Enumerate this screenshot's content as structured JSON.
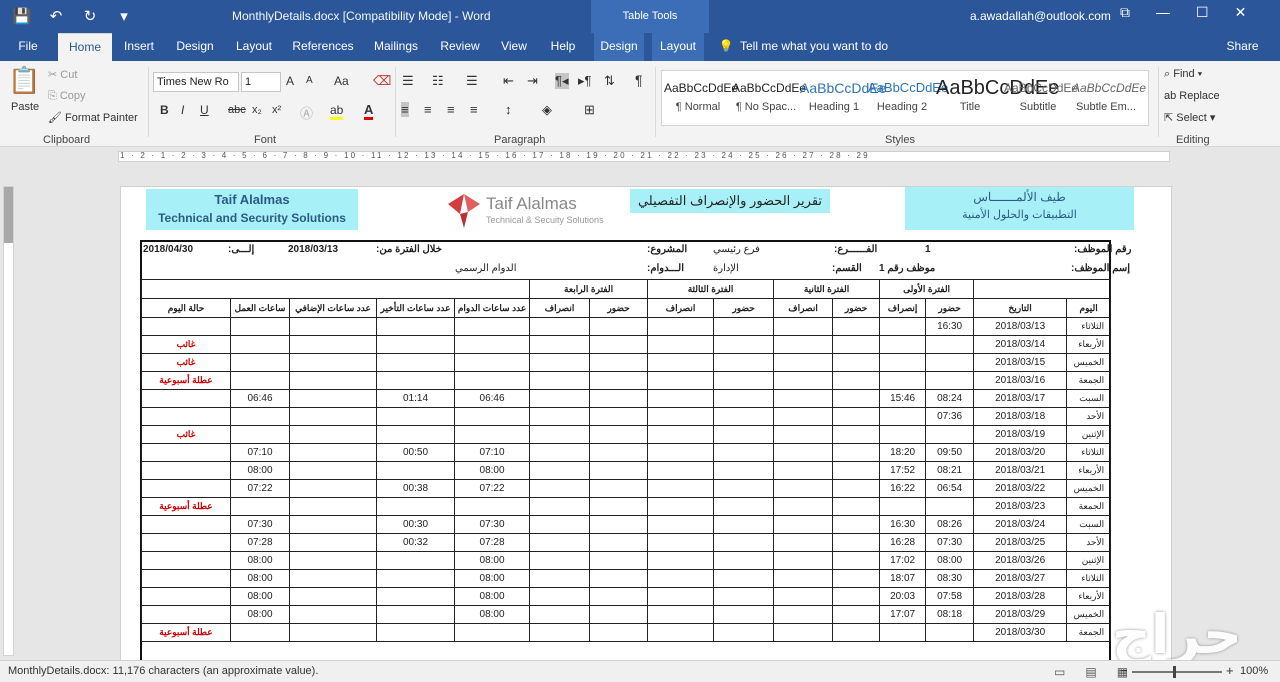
{
  "titlebar": {
    "document_title": "MonthlyDetails.docx [Compatibility Mode]  -  Word",
    "context_tab": "Table Tools",
    "account": "a.awadallah@outlook.com",
    "save_icon": "💾",
    "undo_icon": "↶",
    "redo_icon": "↻",
    "customize_icon": "▾",
    "restore_icon": "⧉",
    "minimize_icon": "—",
    "maximize_icon": "☐",
    "close_icon": "✕"
  },
  "tabs": {
    "file": "File",
    "home": "Home",
    "insert": "Insert",
    "design": "Design",
    "layout": "Layout",
    "references": "References",
    "mailings": "Mailings",
    "review": "Review",
    "view": "View",
    "help": "Help",
    "table_design": "Design",
    "table_layout": "Layout",
    "tell_me": "Tell me what you want to do",
    "share": "Share"
  },
  "clipboard": {
    "paste": "Paste",
    "cut": "Cut",
    "copy": "Copy",
    "format_painter": "Format Painter",
    "label": "Clipboard"
  },
  "font": {
    "name": "Times New Ro",
    "size": "1",
    "label": "Font",
    "bold": "B",
    "italic": "I",
    "underline": "U",
    "strike": "abc",
    "subscript": "x₂",
    "superscript": "x²",
    "grow": "A",
    "shrink": "A",
    "change_case": "Aa",
    "font_color": "A"
  },
  "paragraph": {
    "label": "Paragraph",
    "show_marks": "¶"
  },
  "styles": {
    "label": "Styles",
    "items": [
      {
        "preview": "AaBbCcDdEe",
        "name": "¶ Normal"
      },
      {
        "preview": "AaBbCcDdEe",
        "name": "¶ No Spac..."
      },
      {
        "preview": "AaBbCcDdEe",
        "name": "Heading 1"
      },
      {
        "preview": "AaBbCcDdEe",
        "name": "Heading 2"
      },
      {
        "preview": "AaBbCcDdEe",
        "name": "Title"
      },
      {
        "preview": "AaBbCcDdEe",
        "name": "Subtitle"
      },
      {
        "preview": "AaBbCcDdEe",
        "name": "Subtle Em..."
      }
    ]
  },
  "editing": {
    "label": "Editing",
    "find": "Find",
    "replace": "Replace",
    "select": "Select"
  },
  "ruler": {
    "numbers": "1 · 2 · 1 · 2 · 3 · 4 · 5 · 6 · 7 · 8 · 9 · 10 · 11 · 12 · 13 · 14 · 15 · 16 · 17 · 18 · 19 · 20 · 21 · 22 · 23 · 24 · 25 · 26 · 27 · 28 · 29"
  },
  "document": {
    "company_en_line1": "Taif Alalmas",
    "company_en_line2": "Technical and Security Solutions",
    "logo_name": "Taif Alalmas",
    "logo_tagline": "Technical & Secuity Solutions",
    "report_title": "تقرير الحضور والإنصراف التفصيلي",
    "company_ar_line1": "طيف الألمـــــــاس",
    "company_ar_line2": "التطبيقات والحلول الأمنية",
    "info": {
      "employee_no_label": "رقم الموظف:",
      "employee_no": "1",
      "employee_name_label": "إسم الموظف:",
      "employee_name": "موظف رقم 1",
      "branch_label": "الفــــــرع:",
      "branch": "فرع رئيسي",
      "section_label": "القسم:",
      "section": "الإدارة",
      "project_label": "المشروع:",
      "shift_label": "الـــدوام:",
      "shift": "الدوام الرسمي",
      "period_label": "خلال الفترة من:",
      "from": "2018/03/13",
      "to_label": "إلـــى:",
      "to": "2018/04/30"
    },
    "table": {
      "periods": [
        "الفترة الأولى",
        "الفترة الثانية",
        "الفترة الثالثة",
        "الفترة الرابعة"
      ],
      "headers": [
        "اليوم",
        "التاريخ",
        "حضور",
        "إنصراف",
        "حضور",
        "انصراف",
        "حضور",
        "انصراف",
        "حضور",
        "انصراف",
        "عدد ساعات الدوام",
        "عدد ساعات التأخير",
        "عدد ساعات الإضافي",
        "ساعات العمل",
        "حالة اليوم"
      ],
      "rows": [
        {
          "day": "الثلاثاء",
          "date": "2018/03/13",
          "in1": "16:30",
          "out1": "",
          "duty": "",
          "late": "",
          "work": "",
          "status": ""
        },
        {
          "day": "الأربعاء",
          "date": "2018/03/14",
          "in1": "",
          "out1": "",
          "duty": "",
          "late": "",
          "work": "",
          "status": "غائب"
        },
        {
          "day": "الخميس",
          "date": "2018/03/15",
          "in1": "",
          "out1": "",
          "duty": "",
          "late": "",
          "work": "",
          "status": "غائب"
        },
        {
          "day": "الجمعة",
          "date": "2018/03/16",
          "in1": "",
          "out1": "",
          "duty": "",
          "late": "",
          "work": "",
          "status": "عطلة أسبوعية"
        },
        {
          "day": "السبت",
          "date": "2018/03/17",
          "in1": "08:24",
          "out1": "15:46",
          "duty": "06:46",
          "late": "01:14",
          "work": "06:46",
          "status": ""
        },
        {
          "day": "الأحد",
          "date": "2018/03/18",
          "in1": "07:36",
          "out1": "",
          "duty": "",
          "late": "",
          "work": "",
          "status": ""
        },
        {
          "day": "الإثنين",
          "date": "2018/03/19",
          "in1": "",
          "out1": "",
          "duty": "",
          "late": "",
          "work": "",
          "status": "غائب"
        },
        {
          "day": "الثلاثاء",
          "date": "2018/03/20",
          "in1": "09:50",
          "out1": "18:20",
          "duty": "07:10",
          "late": "00:50",
          "work": "07:10",
          "status": ""
        },
        {
          "day": "الأربعاء",
          "date": "2018/03/21",
          "in1": "08:21",
          "out1": "17:52",
          "duty": "08:00",
          "late": "",
          "work": "08:00",
          "status": ""
        },
        {
          "day": "الخميس",
          "date": "2018/03/22",
          "in1": "06:54",
          "out1": "16:22",
          "duty": "07:22",
          "late": "00:38",
          "work": "07:22",
          "status": ""
        },
        {
          "day": "الجمعة",
          "date": "2018/03/23",
          "in1": "",
          "out1": "",
          "duty": "",
          "late": "",
          "work": "",
          "status": "عطلة أسبوعية"
        },
        {
          "day": "السبت",
          "date": "2018/03/24",
          "in1": "08:26",
          "out1": "16:30",
          "duty": "07:30",
          "late": "00:30",
          "work": "07:30",
          "status": ""
        },
        {
          "day": "الأحد",
          "date": "2018/03/25",
          "in1": "07:30",
          "out1": "16:28",
          "duty": "07:28",
          "late": "00:32",
          "work": "07:28",
          "status": ""
        },
        {
          "day": "الإثنين",
          "date": "2018/03/26",
          "in1": "08:00",
          "out1": "17:02",
          "duty": "08:00",
          "late": "",
          "work": "08:00",
          "status": ""
        },
        {
          "day": "الثلاثاء",
          "date": "2018/03/27",
          "in1": "08:30",
          "out1": "18:07",
          "duty": "08:00",
          "late": "",
          "work": "08:00",
          "status": ""
        },
        {
          "day": "الأربعاء",
          "date": "2018/03/28",
          "in1": "07:58",
          "out1": "20:03",
          "duty": "08:00",
          "late": "",
          "work": "08:00",
          "status": ""
        },
        {
          "day": "الخميس",
          "date": "2018/03/29",
          "in1": "08:18",
          "out1": "17:07",
          "duty": "08:00",
          "late": "",
          "work": "08:00",
          "status": ""
        },
        {
          "day": "الجمعة",
          "date": "2018/03/30",
          "in1": "",
          "out1": "",
          "duty": "",
          "late": "",
          "work": "",
          "status": "عطلة أسبوعية"
        }
      ]
    }
  },
  "statusbar": {
    "text": "MonthlyDetails.docx: 11,176 characters (an approximate value).",
    "zoom": "100%",
    "zoom_out": "−",
    "zoom_in": "+"
  },
  "watermark": "حراج"
}
